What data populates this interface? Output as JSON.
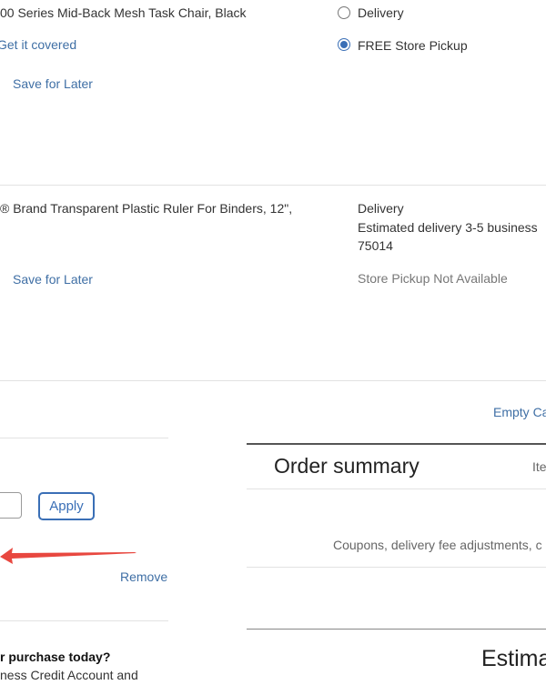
{
  "cart": {
    "items": [
      {
        "title": "00 Series Mid-Back Mesh Task Chair, Black",
        "protection_link": "Get it covered",
        "save_for_later": "Save for Later",
        "fulfillment": {
          "delivery_label": "Delivery",
          "pickup_label": "FREE Store Pickup",
          "selected": "pickup"
        }
      },
      {
        "title": "® Brand Transparent Plastic Ruler For Binders, 12\",",
        "save_for_later": "Save for Later",
        "fulfillment": {
          "delivery_label": "Delivery",
          "delivery_estimate": "Estimated delivery 3-5 business",
          "zip": "75014",
          "pickup_status": "Store Pickup Not Available"
        }
      }
    ],
    "empty_cart_link": "Empty Ca"
  },
  "coupon": {
    "apply_label": "Apply",
    "remove_label": "Remove"
  },
  "credit_promo": {
    "heading": "r purchase today?",
    "text": "ness Credit Account and"
  },
  "order_summary": {
    "title": "Order summary",
    "items_label": "Ite",
    "coupons_note": "Coupons, delivery fee adjustments, c",
    "estimated_label": "Estima"
  },
  "colors": {
    "link": "#3f6fa5",
    "accent": "#3a6fb6",
    "arrow": "#e8473f",
    "divider": "#e2e2e2"
  }
}
